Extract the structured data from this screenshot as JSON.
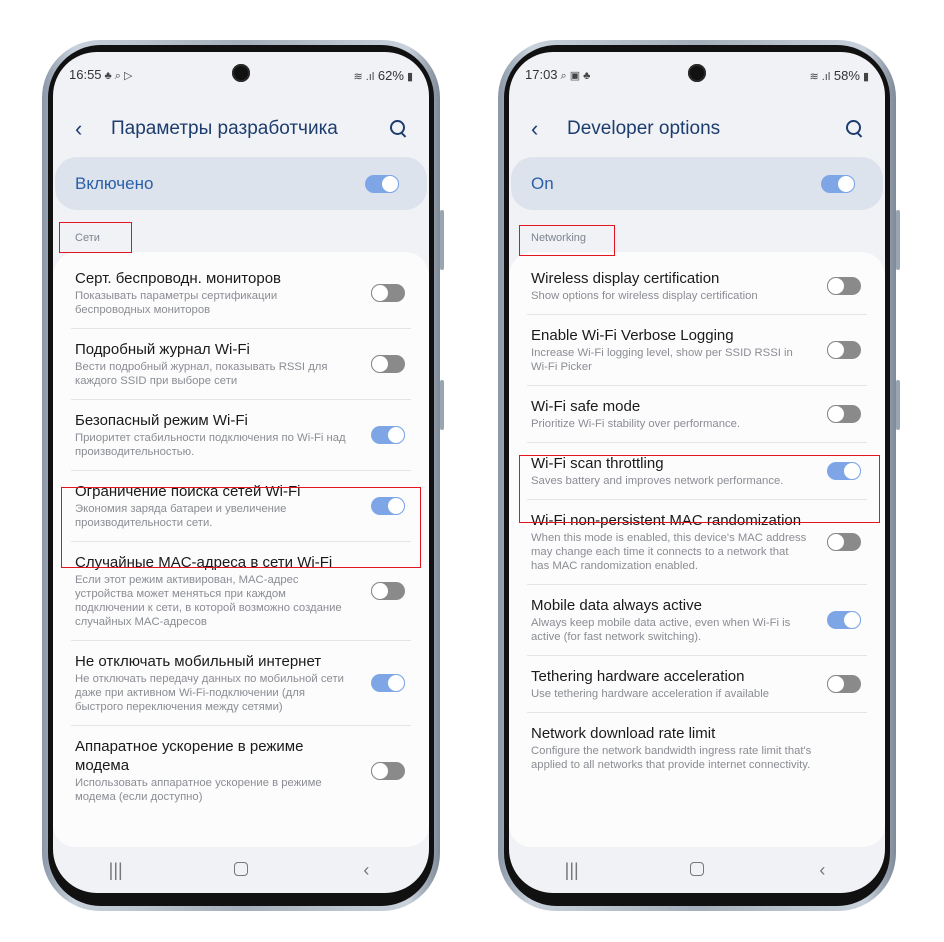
{
  "colors": {
    "accent": "#2a5fa8",
    "toggle_on": "#7ea6e6",
    "toggle_off": "#8a8a8a",
    "highlight": "#e3141d"
  },
  "phones": [
    {
      "status": {
        "time": "16:55",
        "icons": [
          "notification-icon",
          "search-icon",
          "play-icon"
        ],
        "battery": "62%"
      },
      "header": {
        "title": "Параметры разработчика"
      },
      "master": {
        "label": "Включено",
        "on": true
      },
      "section": "Сети",
      "items": [
        {
          "title": "Серт. беспроводн. мониторов",
          "desc": "Показывать параметры сертификации беспроводных мониторов",
          "on": false
        },
        {
          "title": "Подробный журнал Wi-Fi",
          "desc": "Вести подробный журнал, показывать RSSI для каждого SSID при выборе сети",
          "on": false
        },
        {
          "title": "Безопасный режим Wi-Fi",
          "desc": "Приоритет стабильности подключения по Wi-Fi над производительностью.",
          "on": true
        },
        {
          "title": "Ограничение поиска сетей Wi-Fi",
          "desc": "Экономия заряда батареи и увеличение производительности сети.",
          "on": true
        },
        {
          "title": "Случайные MAC-адреса в сети Wi-Fi",
          "desc": "Если этот режим активирован, MAC-адрес устройства может меняться при каждом подключении к сети, в которой возможно создание случайных MAC-адресов",
          "on": false
        },
        {
          "title": "Не отключать мобильный интернет",
          "desc": "Не отключать передачу данных по мобильной сети даже при активном Wi-Fi-подключении (для быстрого переключения между сетями)",
          "on": true
        },
        {
          "title": "Аппаратное ускорение в режиме модема",
          "desc": "Использовать аппаратное ускорение в режиме модема (если доступно)",
          "on": false
        }
      ]
    },
    {
      "status": {
        "time": "17:03",
        "icons": [
          "search-icon",
          "gallery-icon",
          "notification-icon"
        ],
        "battery": "58%"
      },
      "header": {
        "title": "Developer options"
      },
      "master": {
        "label": "On",
        "on": true
      },
      "section": "Networking",
      "items": [
        {
          "title": "Wireless display certification",
          "desc": "Show options for wireless display certification",
          "on": false
        },
        {
          "title": "Enable Wi-Fi Verbose Logging",
          "desc": "Increase Wi-Fi logging level, show per SSID RSSI in Wi-Fi Picker",
          "on": false
        },
        {
          "title": "Wi-Fi safe mode",
          "desc": "Prioritize Wi-Fi stability over performance.",
          "on": false
        },
        {
          "title": "Wi-Fi scan throttling",
          "desc": "Saves battery and improves network performance.",
          "on": true
        },
        {
          "title": "Wi-Fi non-persistent MAC randomization",
          "desc": "When this mode is enabled, this device's MAC address may change each time it connects to a network that has MAC randomization enabled.",
          "on": false
        },
        {
          "title": "Mobile data always active",
          "desc": "Always keep mobile data active, even when Wi-Fi is active (for fast network switching).",
          "on": true
        },
        {
          "title": "Tethering hardware acceleration",
          "desc": "Use tethering hardware acceleration if available",
          "on": false
        },
        {
          "title": "Network download rate limit",
          "desc": "Configure the network bandwidth ingress rate limit that's applied to all networks that provide internet connectivity.",
          "toggle": false
        }
      ]
    }
  ]
}
